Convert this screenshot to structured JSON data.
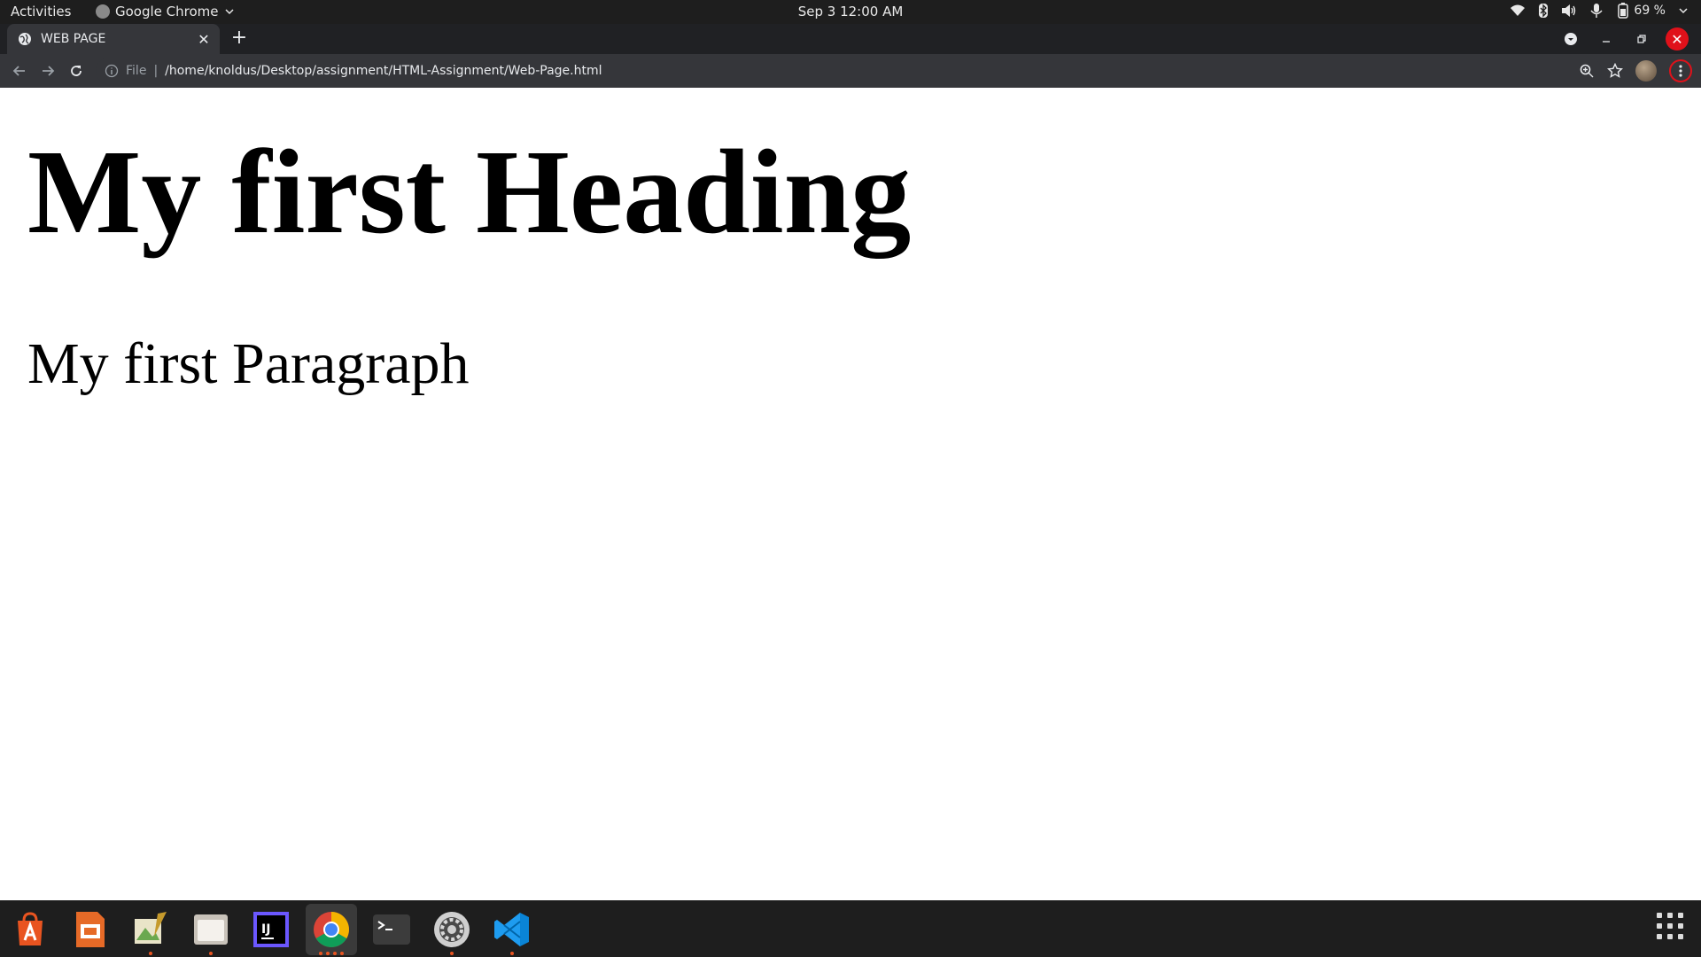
{
  "topbar": {
    "activities": "Activities",
    "app_name": "Google Chrome",
    "clock": "Sep 3  12:00 AM",
    "battery": "69 %"
  },
  "tabs": [
    {
      "title": "WEB PAGE",
      "icon": "globe-icon"
    }
  ],
  "omnibox": {
    "scheme": "File",
    "url": "/home/knoldus/Desktop/assignment/HTML-Assignment/Web-Page.html"
  },
  "page": {
    "heading": "My first Heading",
    "paragraph": "My first Paragraph"
  },
  "dock": {
    "apps": [
      {
        "name": "ubuntu-software-icon",
        "color": "#e95420"
      },
      {
        "name": "impress-icon",
        "color": "#e66a27"
      },
      {
        "name": "image-viewer-icon",
        "color": "#6aa84f"
      },
      {
        "name": "files-icon",
        "color": "#c9c3ba"
      },
      {
        "name": "intellij-icon",
        "color": "#1b1b1b"
      },
      {
        "name": "chrome-icon",
        "color": "#4285f4"
      },
      {
        "name": "terminal-icon",
        "color": "#3c3c3c"
      },
      {
        "name": "settings-icon",
        "color": "#cfcfcf"
      },
      {
        "name": "vscode-icon",
        "color": "#0a84d6"
      }
    ]
  },
  "colors": {
    "accent": "#e95420",
    "close_button": "#e0111a",
    "chrome_dark": "#35363a"
  }
}
